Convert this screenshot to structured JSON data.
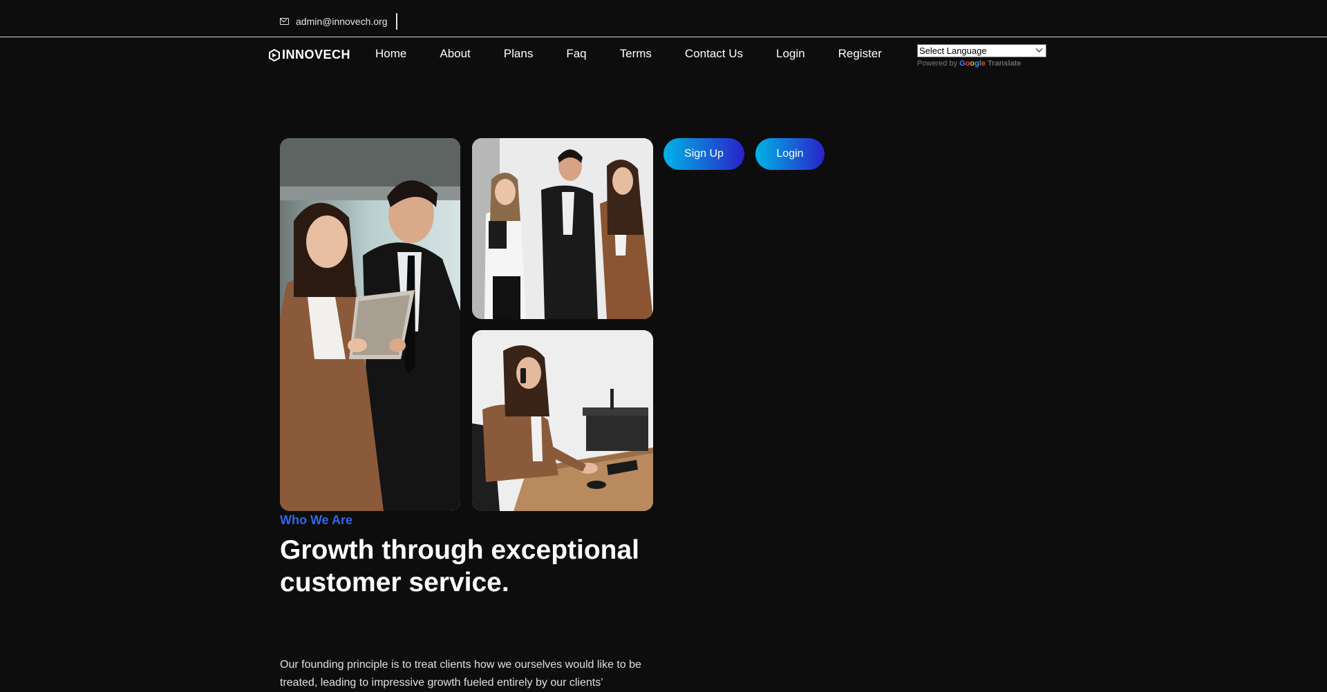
{
  "topbar": {
    "email": "admin@innovech.org"
  },
  "brand": {
    "name": "INNOVECH"
  },
  "nav": {
    "items": [
      {
        "label": "Home"
      },
      {
        "label": "About"
      },
      {
        "label": "Plans"
      },
      {
        "label": "Faq"
      },
      {
        "label": "Terms"
      },
      {
        "label": "Contact Us"
      },
      {
        "label": "Login"
      },
      {
        "label": "Register"
      }
    ]
  },
  "translate": {
    "select_value": "Select Language",
    "powered_by": "Powered by",
    "google": "Google",
    "translate_label": "Translate"
  },
  "hero": {
    "signup_label": "Sign Up",
    "login_label": "Login",
    "eyebrow": "Who We Are",
    "headline": "Growth through exceptional customer service.",
    "body": "Our founding principle is to treat clients how we ourselves would like to be treated, leading to impressive growth fueled entirely by our clients’"
  },
  "colors": {
    "background": "#0d0d0d",
    "accent_blue": "#2f67e8",
    "gradient_start": "#00b4e6",
    "gradient_end": "#2a22c8"
  },
  "icons": {
    "email": "mail-icon",
    "brand": "logo-icon",
    "dropdown": "chevron-down-icon"
  }
}
